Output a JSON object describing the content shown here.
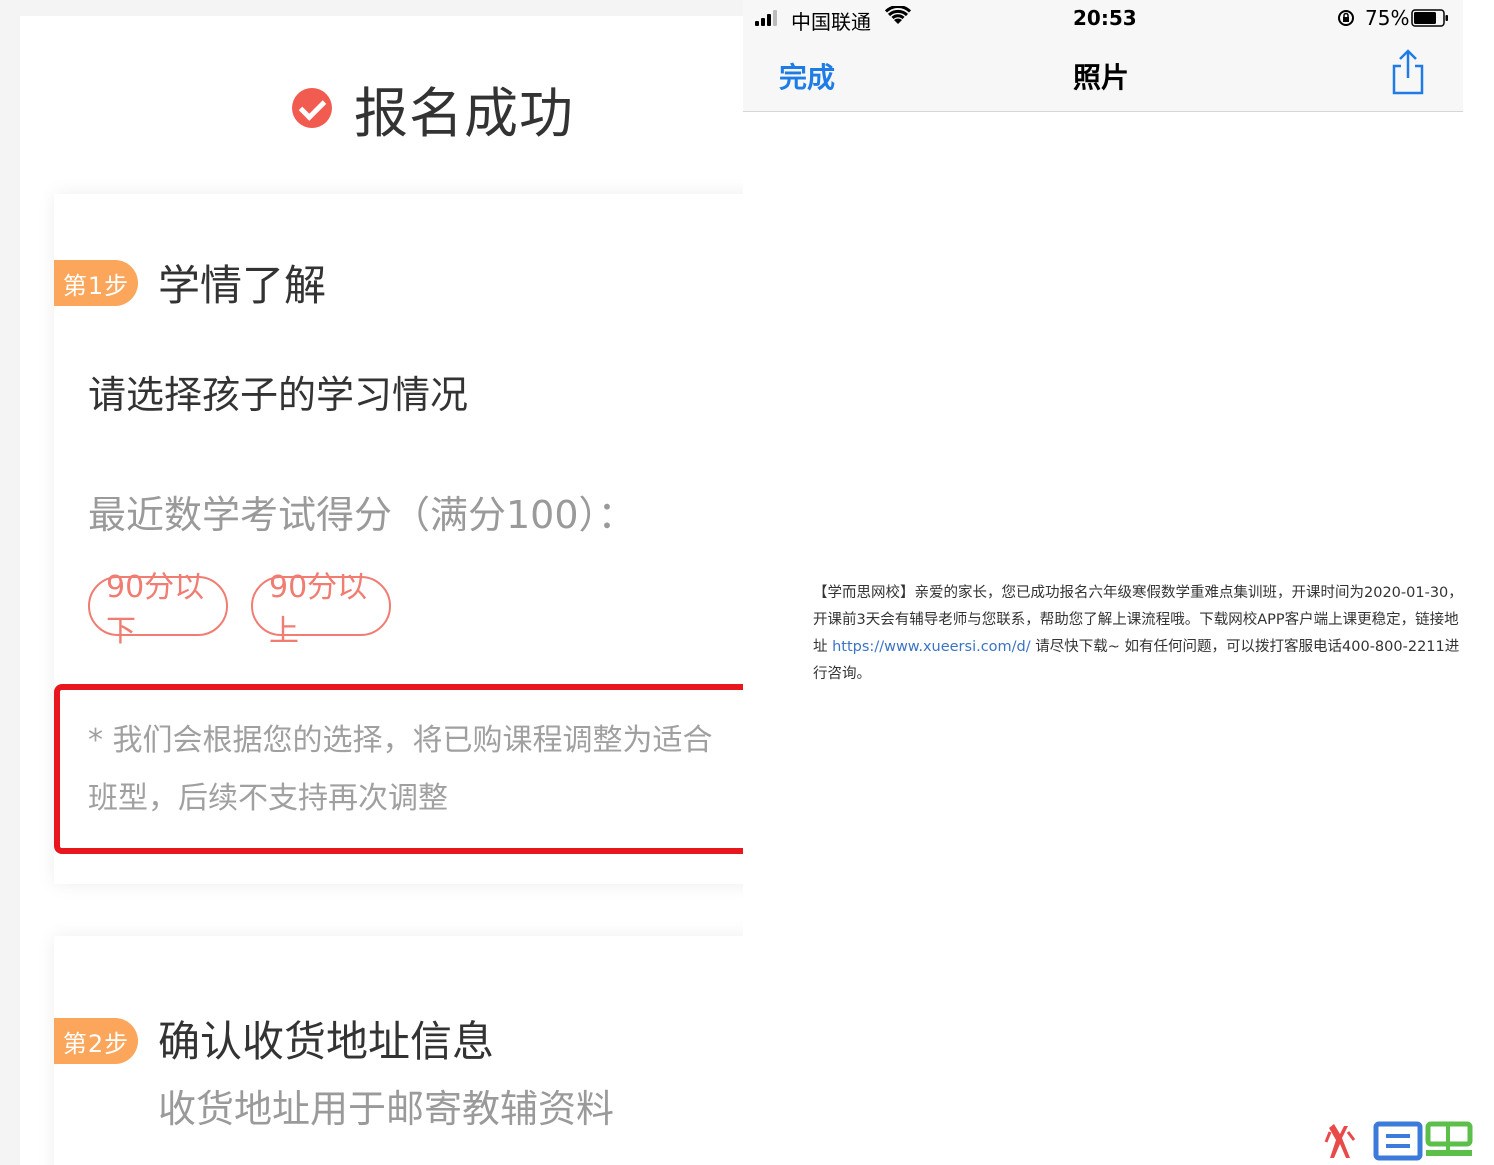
{
  "left": {
    "title": "报名成功",
    "step1": {
      "badge": "第1步",
      "title": "学情了解",
      "question": "请选择孩子的学习情况",
      "subquestion": "最近数学考试得分（满分100）：",
      "options": [
        "90分以下",
        "90分以上"
      ],
      "notice": "* 我们会根据您的选择，将已购课程调整为适合班型，后续不支持再次调整"
    },
    "step2": {
      "badge": "第2步",
      "title": "确认收货地址信息",
      "subtitle": "收货地址用于邮寄教辅资料"
    }
  },
  "right": {
    "status": {
      "carrier": "中国联通",
      "time": "20:53",
      "battery": "75%"
    },
    "nav": {
      "done": "完成",
      "title": "照片"
    },
    "sms": {
      "before_link": "【学而思网校】亲爱的家长，您已成功报名六年级寒假数学重难点集训班，开课时间为2020-01-30，开课前3天会有辅导老师与您联系，帮助您了解上课流程哦。下载网校APP客户端上课更稳定，链接地址 ",
      "link": "https://www.xueersi.com/d/",
      "after_link": " 请尽快下载~ 如有任何问题，可以拨打客服电话400-800-2211进行咨询。"
    }
  },
  "colors": {
    "accent_red": "#f25b4f",
    "badge_orange": "#fba65b",
    "ios_blue": "#1f7ce6",
    "highlight_border": "#e8171d"
  }
}
